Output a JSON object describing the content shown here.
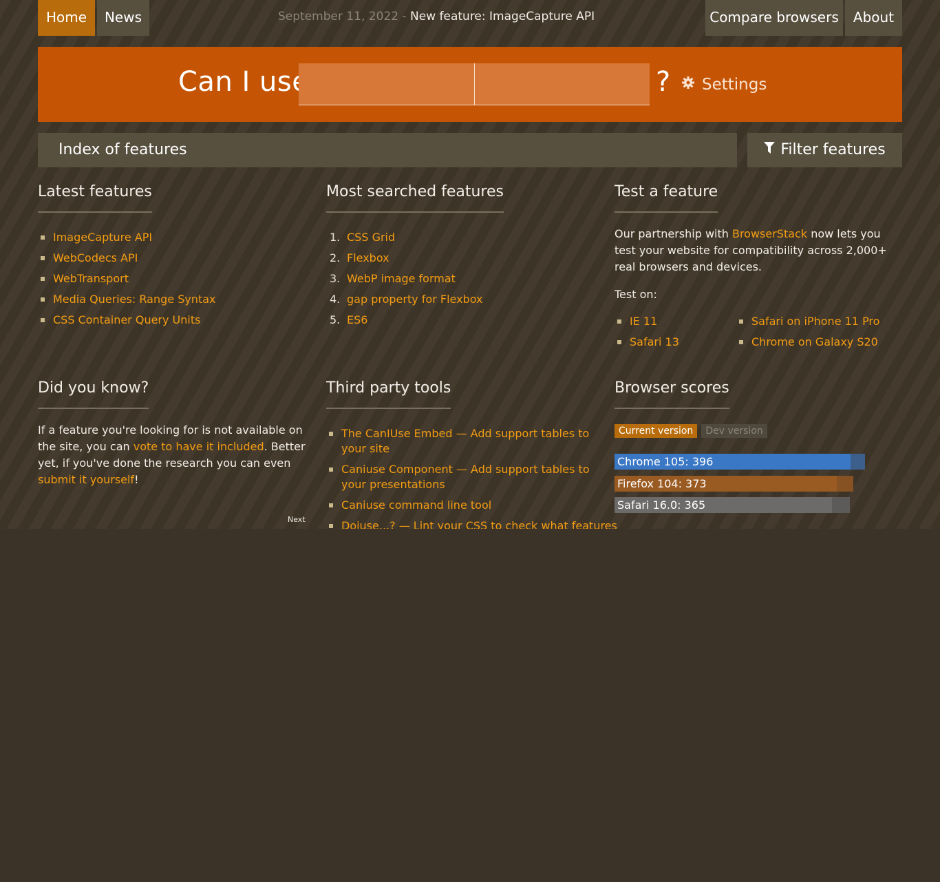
{
  "nav": {
    "home": "Home",
    "news": "News",
    "compare": "Compare browsers",
    "about": "About",
    "news_date": "September 11, 2022 -",
    "news_link": "New feature: ImageCapture API"
  },
  "header": {
    "title": "Can I use",
    "search1_placeholder": "",
    "search2_placeholder": "",
    "question_mark": "?",
    "settings_label": "Settings"
  },
  "index_bar": {
    "label": "Index of features",
    "filter_label": "Filter features"
  },
  "latest": {
    "title": "Latest features",
    "items": [
      "ImageCapture API",
      "WebCodecs API",
      "WebTransport",
      "Media Queries: Range Syntax",
      "CSS Container Query Units"
    ]
  },
  "most_searched": {
    "title": "Most searched features",
    "items": [
      {
        "num": "1.",
        "label": "CSS Grid"
      },
      {
        "num": "2.",
        "label": "Flexbox"
      },
      {
        "num": "3.",
        "label": "WebP image format"
      },
      {
        "num": "4.",
        "label": "gap property for Flexbox"
      },
      {
        "num": "5.",
        "label": "ES6"
      }
    ]
  },
  "test_feature": {
    "title": "Test a feature",
    "text_before": "Our partnership with ",
    "link": "BrowserStack",
    "text_after": " now lets you test your website for compatibility across 2,000+ real browsers and devices.",
    "test_on": "Test on:",
    "items_left": [
      "IE 11",
      "Safari 13"
    ],
    "items_right": [
      "Safari on iPhone 11 Pro",
      "Chrome on Galaxy S20"
    ]
  },
  "did_you_know": {
    "title": "Did you know?",
    "text1": "If a feature you're looking for is not available on the site, you can ",
    "link1": "vote to have it included",
    "text2": ". Better yet, if you've done the research you can even ",
    "link2": "submit it yourself",
    "text3": "!",
    "next": "Next"
  },
  "third_party": {
    "title": "Third party tools",
    "items": [
      "The CanIUse Embed — Add support tables to your site",
      "Caniuse Component — Add support tables to your presentations",
      "Caniuse command line tool",
      "Doiuse...? — Lint your CSS to check what features"
    ]
  },
  "browser_scores": {
    "title": "Browser scores",
    "tab_current": "Current version",
    "tab_dev": "Dev version",
    "scores": [
      {
        "label": "Chrome 105: 396",
        "value": 396,
        "max": 420,
        "color": "#3a77c4",
        "rest_color": "#3d5f8c"
      },
      {
        "label": "Firefox 104: 373",
        "value": 373,
        "max": 400,
        "color": "#9a5b22",
        "rest_color": "#875223"
      },
      {
        "label": "Safari 16.0: 365",
        "value": 365,
        "max": 395,
        "color": "#6d6b69",
        "rest_color": "#5d5b59"
      }
    ]
  },
  "colors": {
    "accent": "#c55505",
    "link": "#f39c12",
    "nav_active": "#b86c0b",
    "nav_bg": "#57503f"
  }
}
